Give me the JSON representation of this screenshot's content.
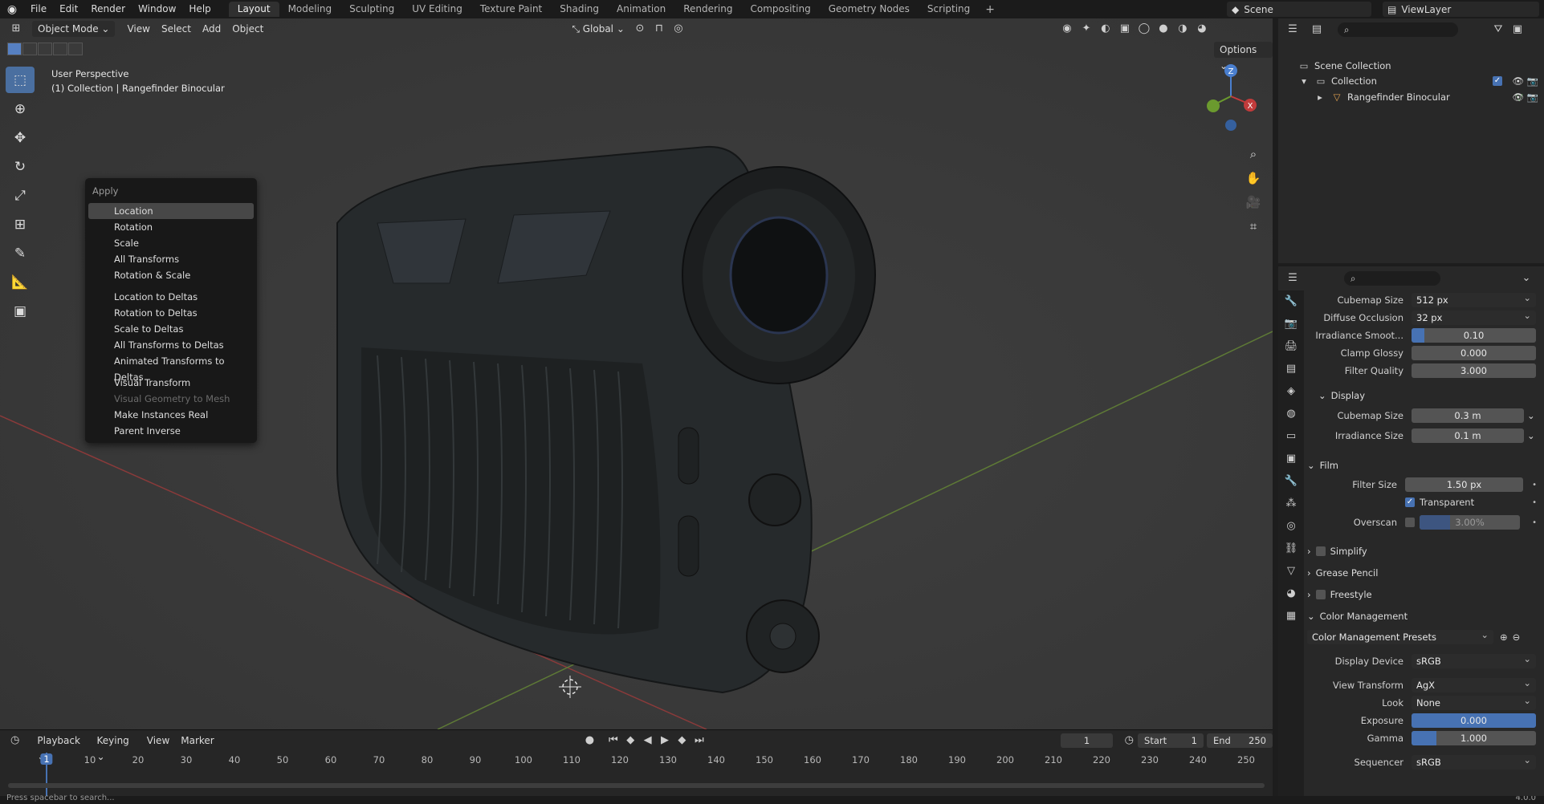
{
  "topbar": {
    "menus": [
      "File",
      "Edit",
      "Render",
      "Window",
      "Help"
    ],
    "workspaces": [
      "Layout",
      "Modeling",
      "Sculpting",
      "UV Editing",
      "Texture Paint",
      "Shading",
      "Animation",
      "Rendering",
      "Compositing",
      "Geometry Nodes",
      "Scripting"
    ],
    "active_workspace": "Layout",
    "scene": "Scene",
    "view_layer": "ViewLayer"
  },
  "viewport": {
    "mode": "Object Mode",
    "menus": [
      "View",
      "Select",
      "Add",
      "Object"
    ],
    "orientation": "Global",
    "options_label": "Options",
    "info_line1": "User Perspective",
    "info_line2": "(1) Collection | Rangefinder Binocular",
    "gizmo": {
      "z": "Z",
      "x": "X"
    }
  },
  "apply_menu": {
    "title": "Apply",
    "group1": [
      "Location",
      "Rotation",
      "Scale",
      "All Transforms",
      "Rotation & Scale"
    ],
    "group2": [
      "Location to Deltas",
      "Rotation to Deltas",
      "Scale to Deltas",
      "All Transforms to Deltas",
      "Animated Transforms to Deltas"
    ],
    "group3": [
      "Visual Transform",
      "Visual Geometry to Mesh",
      "Make Instances Real",
      "Parent Inverse"
    ],
    "active_item": "Location",
    "disabled_item": "Visual Geometry to Mesh"
  },
  "timeline": {
    "menus": [
      "Playback",
      "Keying",
      "View",
      "Marker"
    ],
    "current_frame": "1",
    "start_label": "Start",
    "start": "1",
    "end_label": "End",
    "end": "250",
    "ticks": [
      "1",
      "10",
      "20",
      "30",
      "40",
      "50",
      "60",
      "70",
      "80",
      "90",
      "100",
      "110",
      "120",
      "130",
      "140",
      "150",
      "160",
      "170",
      "180",
      "190",
      "200",
      "210",
      "220",
      "230",
      "240",
      "250"
    ]
  },
  "statusbar": {
    "hint": "Press spacebar to search...",
    "version": "4.0.0"
  },
  "outliner": {
    "scene_collection": "Scene Collection",
    "collection": "Collection",
    "object": "Rangefinder Binocular"
  },
  "properties": {
    "cubemap_size_label": "Cubemap Size",
    "cubemap_size": "512 px",
    "diffuse_occlusion_label": "Diffuse Occlusion",
    "diffuse_occlusion": "32 px",
    "irradiance_smooth_label": "Irradiance Smoot...",
    "irradiance_smooth": "0.10",
    "irradiance_smooth_fill": 0.1,
    "clamp_glossy_label": "Clamp Glossy",
    "clamp_glossy": "0.000",
    "filter_quality_label": "Filter Quality",
    "filter_quality": "3.000",
    "display_section": "Display",
    "display_cubemap_label": "Cubemap Size",
    "display_cubemap": "0.3 m",
    "display_irradiance_label": "Irradiance Size",
    "display_irradiance": "0.1 m",
    "film_section": "Film",
    "filter_size_label": "Filter Size",
    "filter_size": "1.50 px",
    "transparent_label": "Transparent",
    "overscan_label": "Overscan",
    "overscan": "3.00%",
    "overscan_fill": 0.3,
    "simplify_section": "Simplify",
    "grease_pencil_section": "Grease Pencil",
    "freestyle_section": "Freestyle",
    "color_management_section": "Color Management",
    "cm_presets": "Color Management Presets",
    "display_device_label": "Display Device",
    "display_device": "sRGB",
    "view_transform_label": "View Transform",
    "view_transform": "AgX",
    "look_label": "Look",
    "look": "None",
    "exposure_label": "Exposure",
    "exposure": "0.000",
    "gamma_label": "Gamma",
    "gamma": "1.000",
    "gamma_fill": 0.2,
    "sequencer_label": "Sequencer",
    "sequencer": "sRGB"
  },
  "colors": {
    "accent": "#4772b3",
    "active_tab": "#303030",
    "x_axis": "#c23b3b",
    "y_axis": "#6b9a2e"
  }
}
